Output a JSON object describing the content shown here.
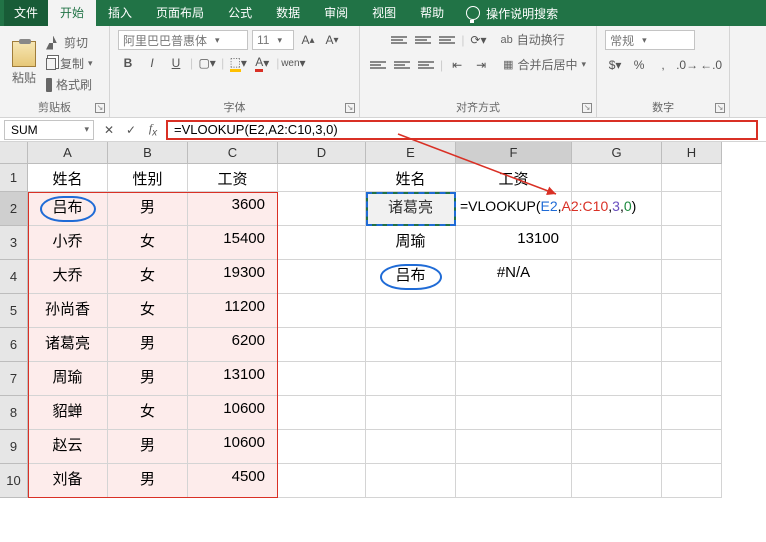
{
  "tabs": {
    "file": "文件",
    "items": [
      "开始",
      "插入",
      "页面布局",
      "公式",
      "数据",
      "审阅",
      "视图",
      "帮助"
    ],
    "active_index": 0,
    "tell_me": "操作说明搜索"
  },
  "ribbon": {
    "clipboard": {
      "paste": "粘贴",
      "cut": "剪切",
      "copy": "复制",
      "format_painter": "格式刷",
      "label": "剪贴板"
    },
    "font": {
      "name": "阿里巴巴普惠体",
      "size": "11",
      "label": "字体",
      "tools": [
        "B",
        "I",
        "U"
      ]
    },
    "alignment": {
      "wrap": "自动换行",
      "merge": "合并后居中",
      "label": "对齐方式"
    },
    "number": {
      "format": "常规",
      "label": "数字"
    }
  },
  "fxbar": {
    "namebox": "SUM",
    "formula": "=VLOOKUP(E2,A2:C10,3,0)"
  },
  "columns": [
    "A",
    "B",
    "C",
    "D",
    "E",
    "F",
    "G",
    "H"
  ],
  "rows": [
    "1",
    "2",
    "3",
    "4",
    "5",
    "6",
    "7",
    "8",
    "9",
    "10"
  ],
  "table1": {
    "headers": [
      "姓名",
      "性别",
      "工资"
    ],
    "data": [
      [
        "吕布",
        "男",
        "3600"
      ],
      [
        "小乔",
        "女",
        "15400"
      ],
      [
        "大乔",
        "女",
        "19300"
      ],
      [
        "孙尚香",
        "女",
        "11200"
      ],
      [
        "诸葛亮",
        "男",
        "6200"
      ],
      [
        "周瑜",
        "男",
        "13100"
      ],
      [
        "貂蝉",
        "女",
        "10600"
      ],
      [
        "赵云",
        "男",
        "10600"
      ],
      [
        "刘备",
        "男",
        "4500"
      ]
    ]
  },
  "table2": {
    "headers": [
      "姓名",
      "工资"
    ],
    "data": [
      [
        "诸葛亮",
        ""
      ],
      [
        "周瑜",
        "13100"
      ],
      [
        "吕布",
        "#N/A"
      ]
    ]
  },
  "formula_overlay": {
    "fn": "=VLOOKUP(",
    "a1": "E2",
    "a2": "A2:C10",
    "a3": "3",
    "a4": "0",
    "close": ")"
  }
}
